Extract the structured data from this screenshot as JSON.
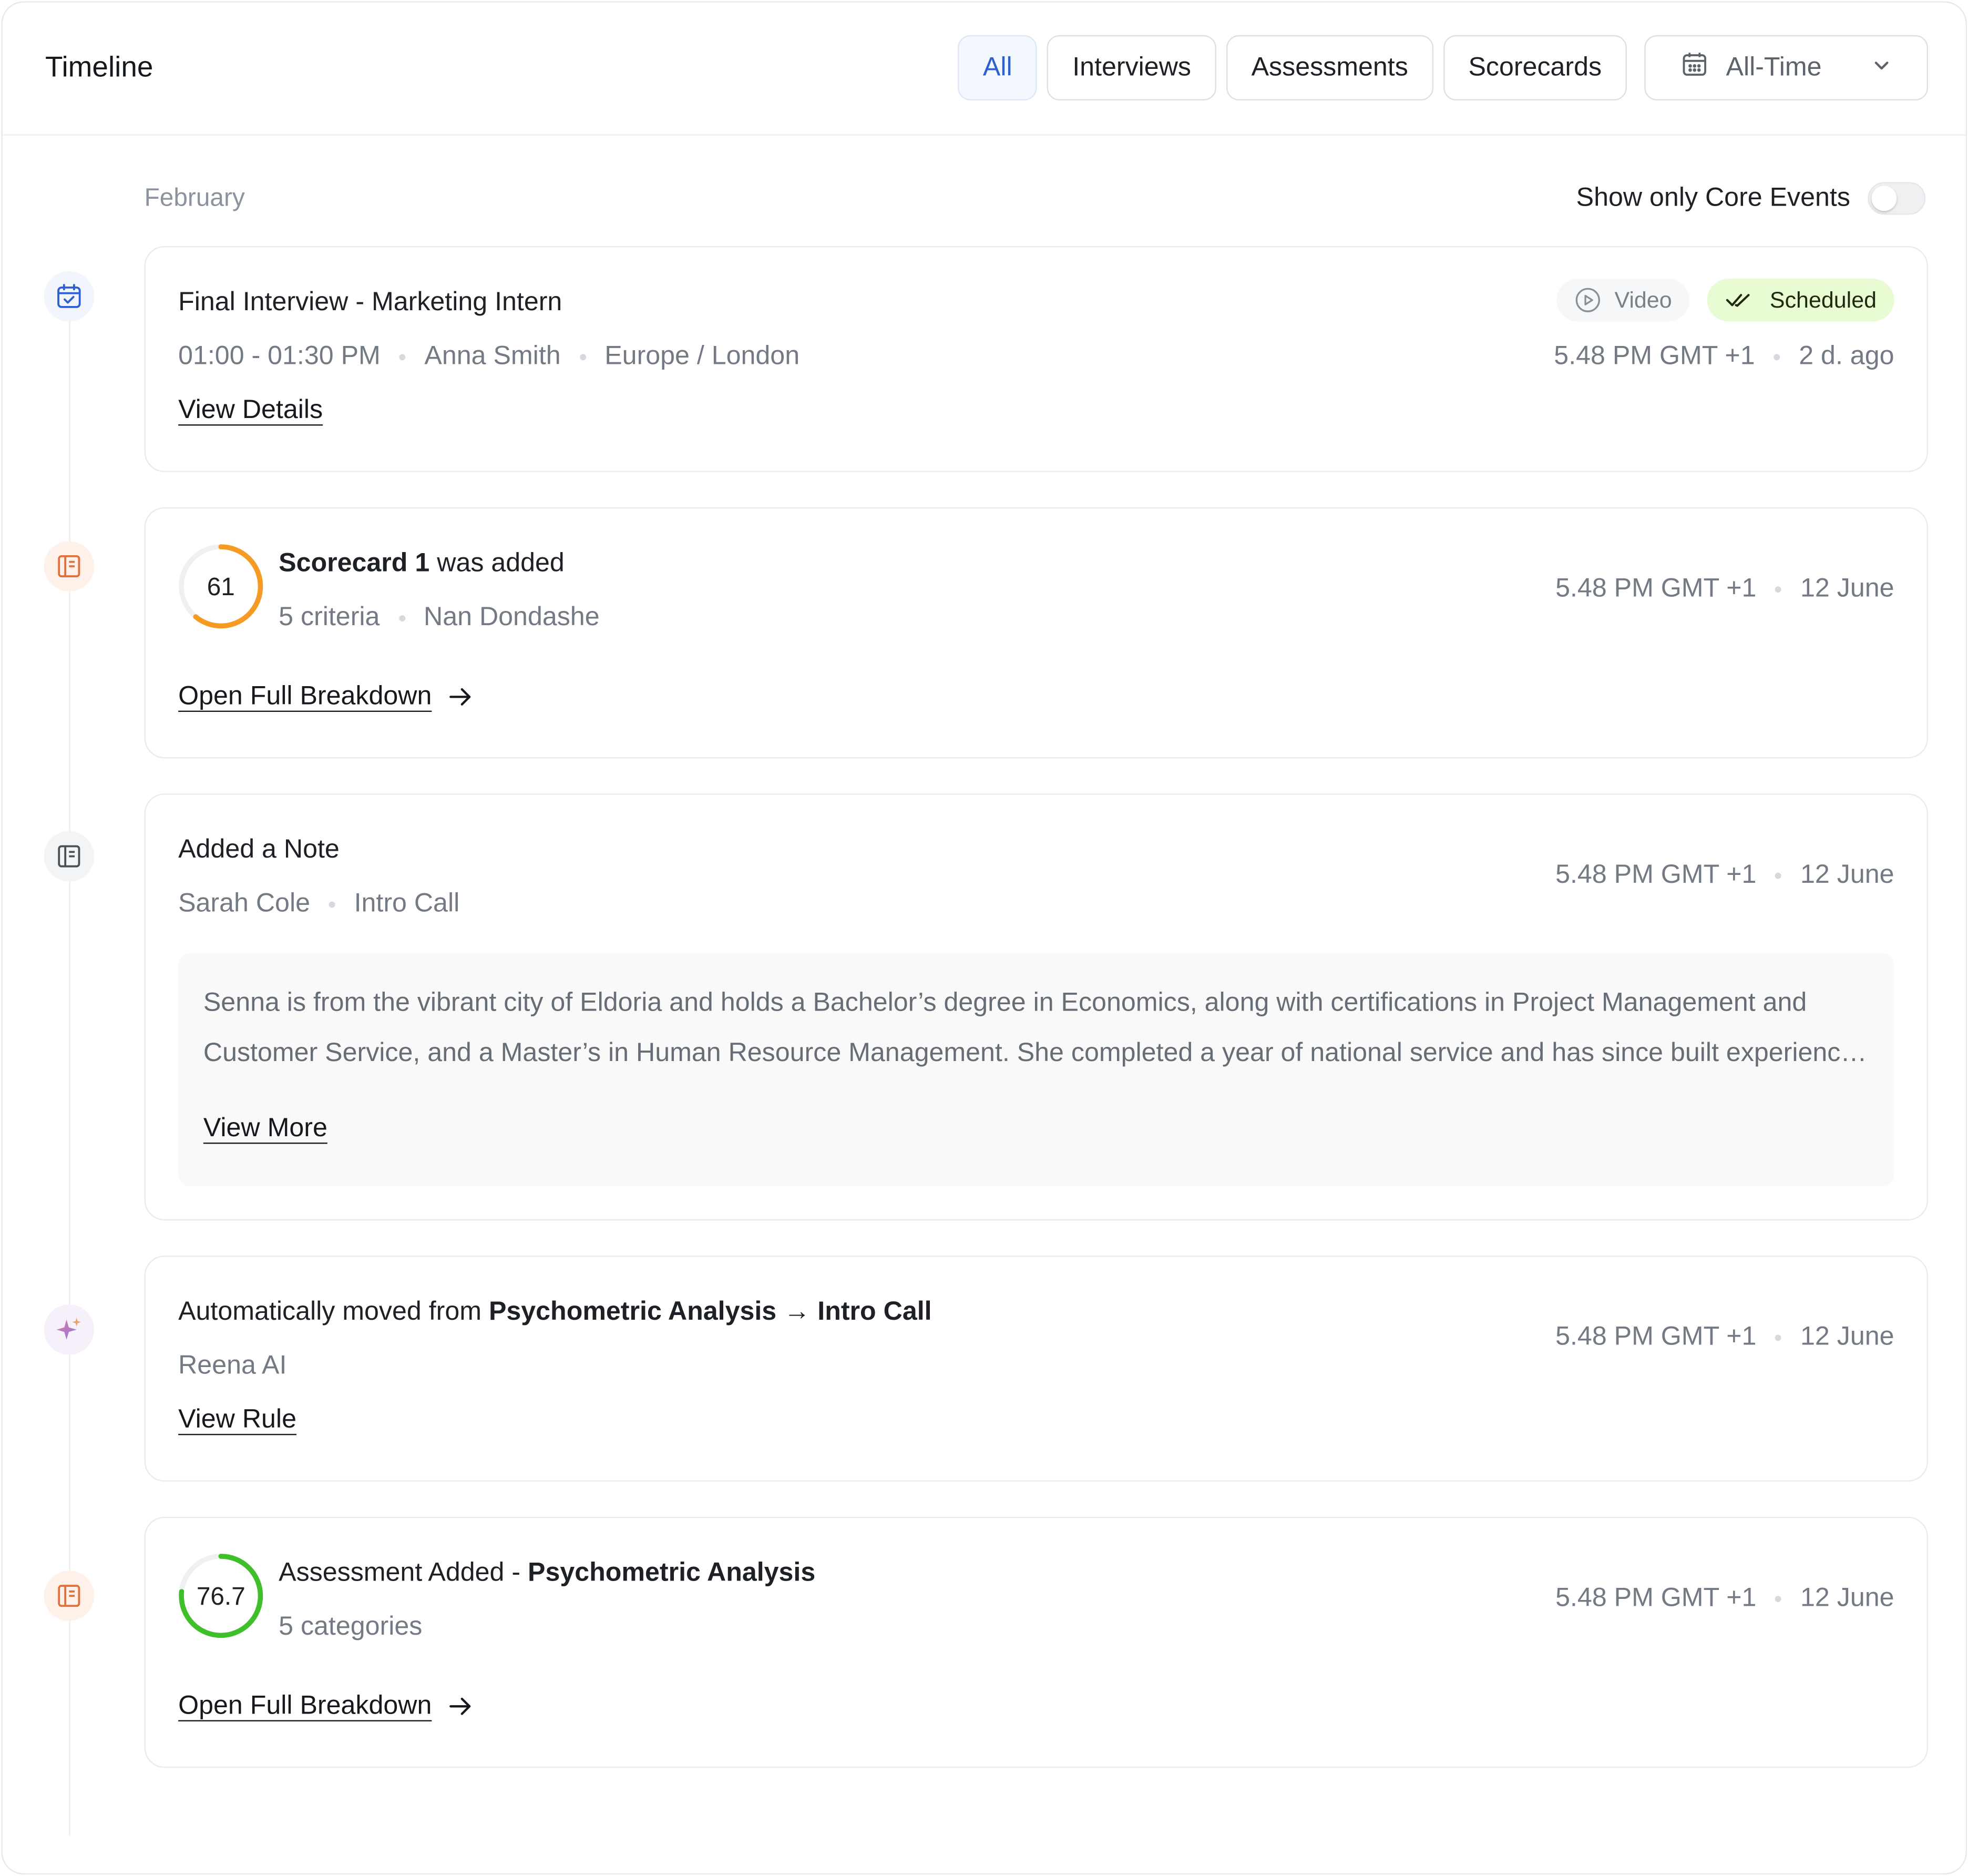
{
  "header": {
    "title": "Timeline",
    "filters": [
      "All",
      "Interviews",
      "Assessments",
      "Scorecards"
    ],
    "active_filter": "All",
    "date_range": "All-Time"
  },
  "month": "February",
  "core_toggle": {
    "label": "Show only Core Events",
    "on": false
  },
  "events": [
    {
      "type": "interview",
      "title": "Final Interview - Marketing Intern",
      "time": "01:00 - 01:30 PM",
      "person": "Anna Smith",
      "timezone": "Europe / London",
      "link": "View Details",
      "badge_video": "Video",
      "badge_status": "Scheduled",
      "meta_time": "5.48 PM GMT +1",
      "meta_date": "2 d. ago"
    },
    {
      "type": "scorecard",
      "title_a": "Scorecard 1",
      "title_b": " was added",
      "score": "61",
      "score_fraction": 0.61,
      "criteria": "5 criteria",
      "person": "Nan Dondashe",
      "link": "Open Full Breakdown",
      "meta_time": "5.48 PM GMT +1",
      "meta_date": "12 June"
    },
    {
      "type": "note",
      "title": "Added a Note",
      "person": "Sarah Cole",
      "stage": "Intro Call",
      "text": "Senna is from the vibrant city of Eldoria and holds a Bachelor’s degree in Economics, along with certifications in Project Management and Customer Service, and a Master’s in Human Resource Management. She completed a year of national service and has since built experience across several roles.",
      "link": "View More",
      "meta_time": "5.48 PM GMT +1",
      "meta_date": "12 June"
    },
    {
      "type": "automation",
      "title_prefix": "Automatically moved from ",
      "from": "Psychometric Analysis",
      "arrow": "→",
      "to": "Intro Call",
      "actor": "Reena AI",
      "link": "View Rule",
      "meta_time": "5.48 PM GMT +1",
      "meta_date": "12 June"
    },
    {
      "type": "assessment",
      "title_a": "Assessment Added - ",
      "title_b": "Psychometric Analysis",
      "score": "76.7",
      "score_fraction": 0.767,
      "categories": "5 categories",
      "link": "Open Full Breakdown",
      "meta_time": "5.48 PM GMT +1",
      "meta_date": "12 June"
    }
  ],
  "colors": {
    "accent_blue": "#2d5fd0",
    "scorecard_ring": "#f59a23",
    "assessment_ring": "#3fbf2a",
    "scheduled_bg": "#e8fbd3",
    "icon_orange": "#e2703a"
  },
  "icons": {
    "date": "calendar-icon",
    "dropdown": "chevron-down-icon",
    "interview": "calendar-check-icon",
    "scorecard": "scorecard-icon",
    "note": "note-icon",
    "automation": "sparkle-icon",
    "assessment": "assessment-icon",
    "video": "play-circle-icon",
    "scheduled": "double-check-icon",
    "arrow": "arrow-right-icon"
  }
}
